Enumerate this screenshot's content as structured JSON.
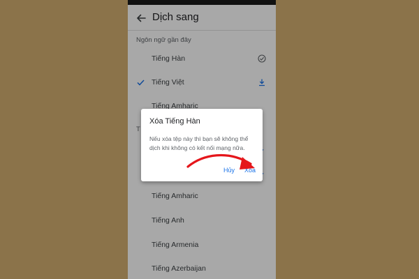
{
  "header": {
    "title": "Dịch sang",
    "back_icon": "arrow-left-icon"
  },
  "recent_section": {
    "label": "Ngôn ngữ gần đây",
    "items": [
      {
        "name": "Tiếng Hàn",
        "status_icon": "downloaded-check-icon",
        "selected": false
      },
      {
        "name": "Tiếng Việt",
        "status_icon": "download-icon",
        "selected": true
      },
      {
        "name": "Tiếng Amharic",
        "status_icon": "",
        "selected": false
      }
    ]
  },
  "all_section": {
    "label_partial": "T",
    "items": [
      {
        "name": "Tiếng Amharic"
      },
      {
        "name": "Tiếng Anh"
      },
      {
        "name": "Tiếng Armenia"
      },
      {
        "name": "Tiếng Azerbaijan"
      }
    ]
  },
  "dialog": {
    "title": "Xóa Tiếng Hàn",
    "body": "Nếu xóa tệp này thì bạn sẽ không thể dịch khi không có kết nối mạng nữa.",
    "cancel_label": "Hủy",
    "confirm_label": "Xóa"
  },
  "colors": {
    "background": "#8b734a",
    "accent": "#1a73e8",
    "annotation_arrow": "#e5161b"
  }
}
